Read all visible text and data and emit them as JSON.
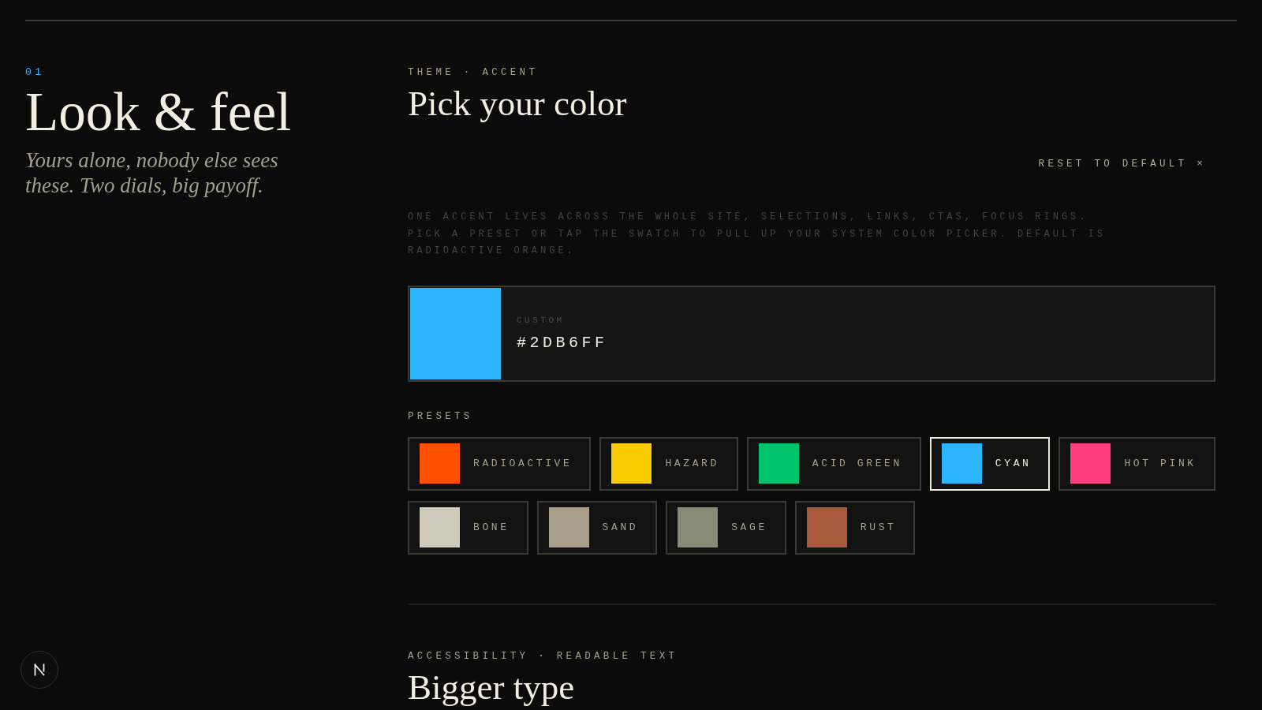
{
  "intro": {
    "index": "01",
    "title": "Look & feel",
    "subtitle": "Yours alone, nobody else sees these. Two dials, big payoff."
  },
  "accent_section": {
    "eyebrow": "THEME · ACCENT",
    "title": "Pick your color",
    "reset_button": "RESET TO DEFAULT ×",
    "description": "ONE ACCENT LIVES ACROSS THE WHOLE SITE, SELECTIONS, LINKS, CTAS, FOCUS RINGS. PICK A PRESET OR TAP THE SWATCH TO PULL UP YOUR SYSTEM COLOR PICKER. DEFAULT IS RADIOACTIVE ORANGE.",
    "custom": {
      "label": "CUSTOM",
      "value": "#2DB6FF"
    },
    "presets_label": "PRESETS",
    "presets": [
      {
        "label": "RADIOACTIVE",
        "color": "#ff5000",
        "selected": false
      },
      {
        "label": "HAZARD",
        "color": "#f8cc00",
        "selected": false
      },
      {
        "label": "ACID GREEN",
        "color": "#00c46c",
        "selected": false
      },
      {
        "label": "CYAN",
        "color": "#2db6ff",
        "selected": true
      },
      {
        "label": "HOT PINK",
        "color": "#ff3d7f",
        "selected": false
      },
      {
        "label": "BONE",
        "color": "#cfcabb",
        "selected": false
      },
      {
        "label": "SAND",
        "color": "#a89e8a",
        "selected": false
      },
      {
        "label": "SAGE",
        "color": "#878b75",
        "selected": false
      },
      {
        "label": "RUST",
        "color": "#a85a3c",
        "selected": false
      }
    ]
  },
  "next_section": {
    "eyebrow": "ACCESSIBILITY · READABLE TEXT",
    "title": "Bigger type"
  }
}
